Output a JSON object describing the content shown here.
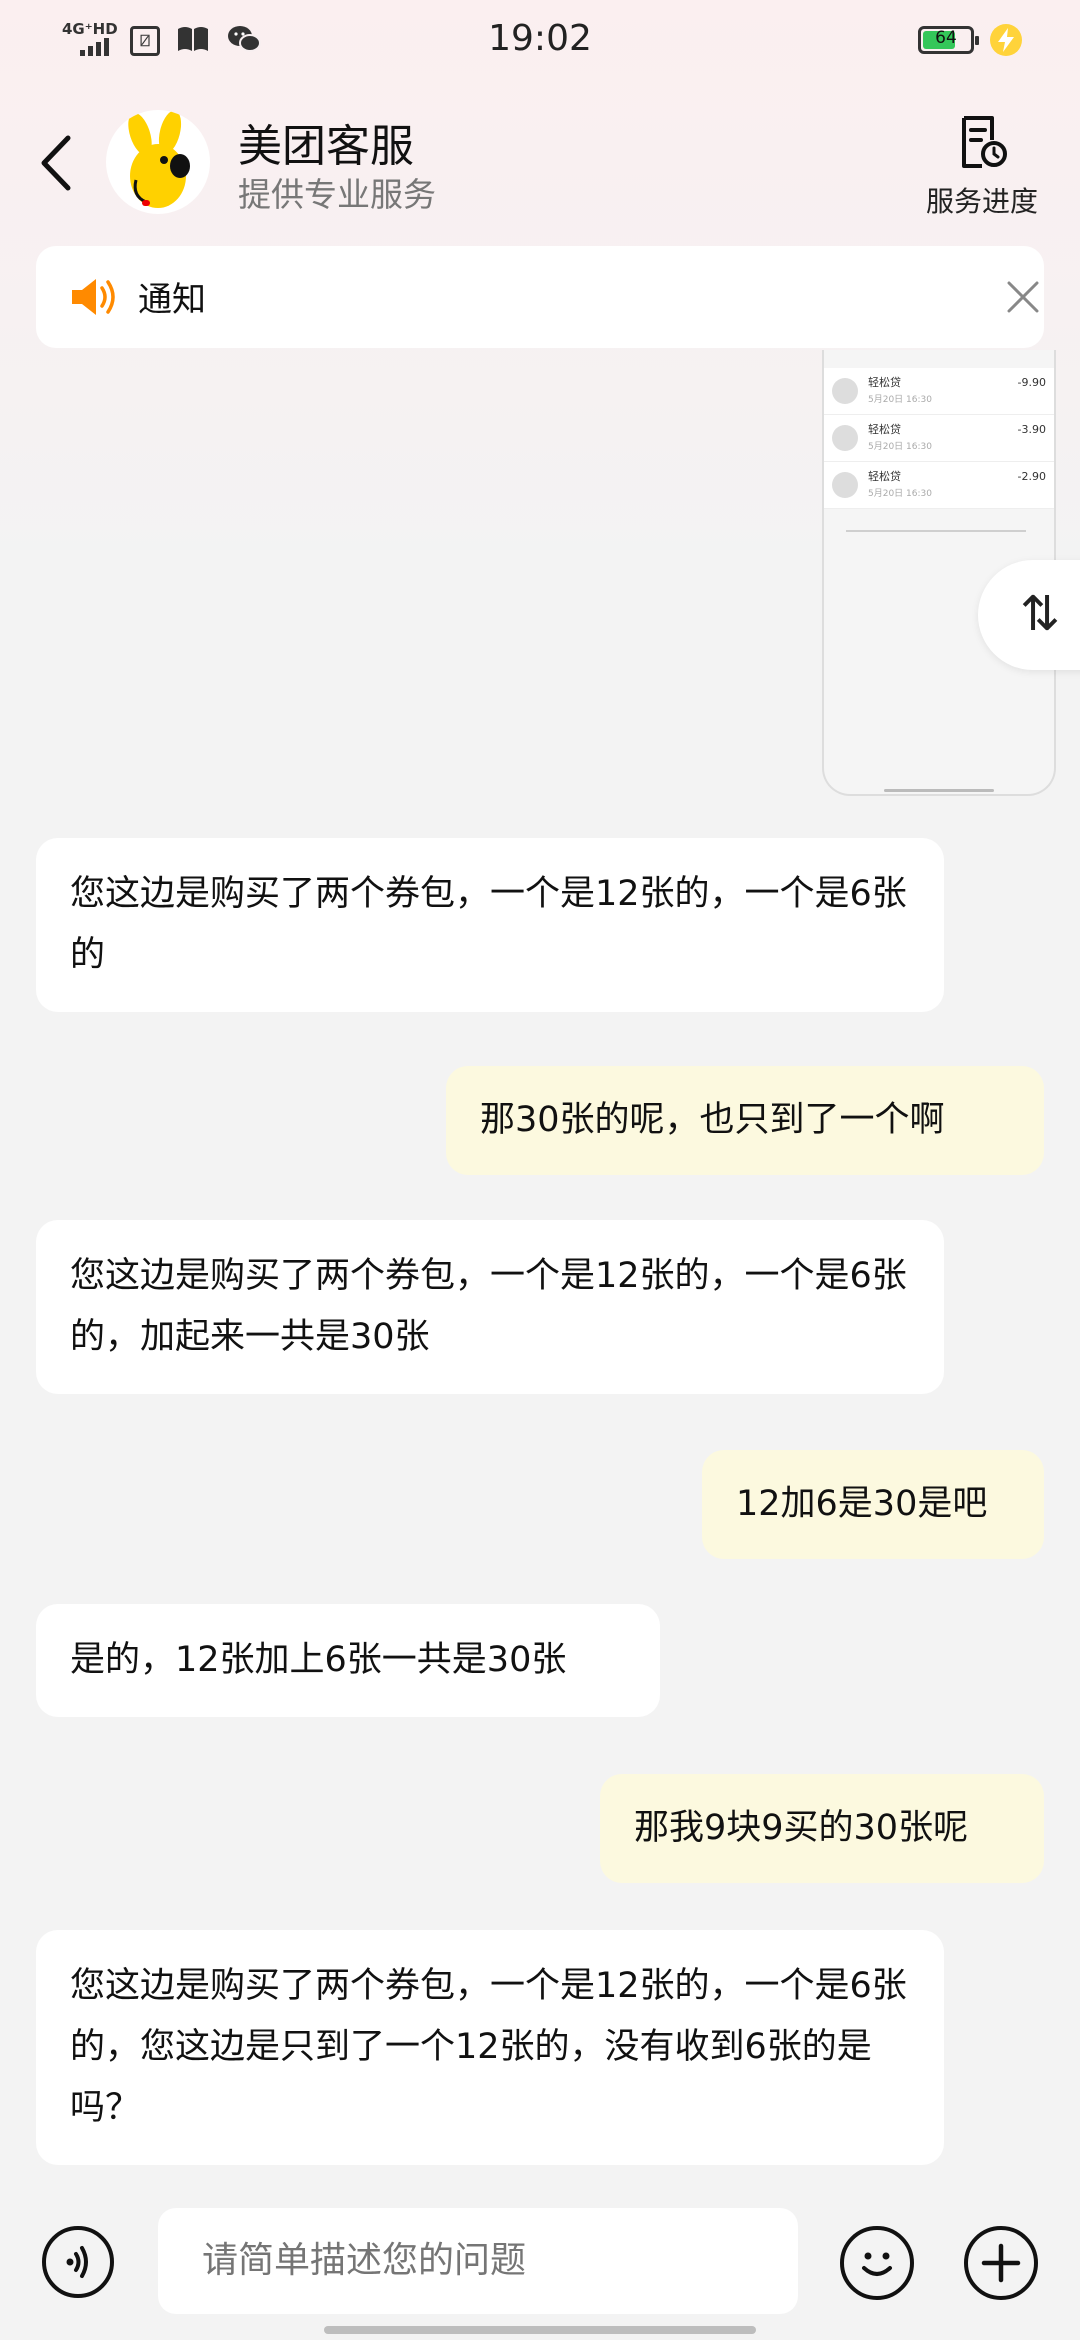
{
  "status_bar": {
    "network": "4G⁺HD",
    "time": "19:02",
    "battery_percent": "64",
    "battery_level": 0.64,
    "battery_color": "#34c759",
    "icons": [
      "signal-icon",
      "sim-icon",
      "book-icon",
      "wechat-icon",
      "battery-icon",
      "charging-icon"
    ]
  },
  "header": {
    "title": "美团客服",
    "subtitle": "提供专业服务",
    "progress_label": "服务进度",
    "accent_color": "#ffd100"
  },
  "notice": {
    "label": "通知",
    "speaker_color": "#ff8a00"
  },
  "thumbnail": {
    "rows": [
      {
        "name": "轻松贷",
        "date": "5月20日 16:30",
        "amount": "-9.90"
      },
      {
        "name": "轻松贷",
        "date": "5月20日 16:30",
        "amount": "-3.90"
      },
      {
        "name": "轻松贷",
        "date": "5月20日 16:30",
        "amount": "-2.90"
      }
    ]
  },
  "sort_fab": {
    "glyph": "⇅"
  },
  "messages": [
    {
      "side": "left",
      "text": "您这边是购买了两个券包，一个是12张的，一个是6张的"
    },
    {
      "side": "right",
      "text": "那30张的呢，也只到了一个啊"
    },
    {
      "side": "left",
      "text": "您这边是购买了两个券包，一个是12张的，一个是6张的，加起来一共是30张"
    },
    {
      "side": "right",
      "text": "12加6是30是吧"
    },
    {
      "side": "left",
      "text": "是的，12张加上6张一共是30张"
    },
    {
      "side": "right",
      "text": "那我9块9买的30张呢"
    },
    {
      "side": "left",
      "text": "您这边是购买了两个券包，一个是12张的，一个是6张的，您这边是只到了一个12张的，没有收到6张的是吗？"
    }
  ],
  "composer": {
    "placeholder": "请简单描述您的问题"
  }
}
